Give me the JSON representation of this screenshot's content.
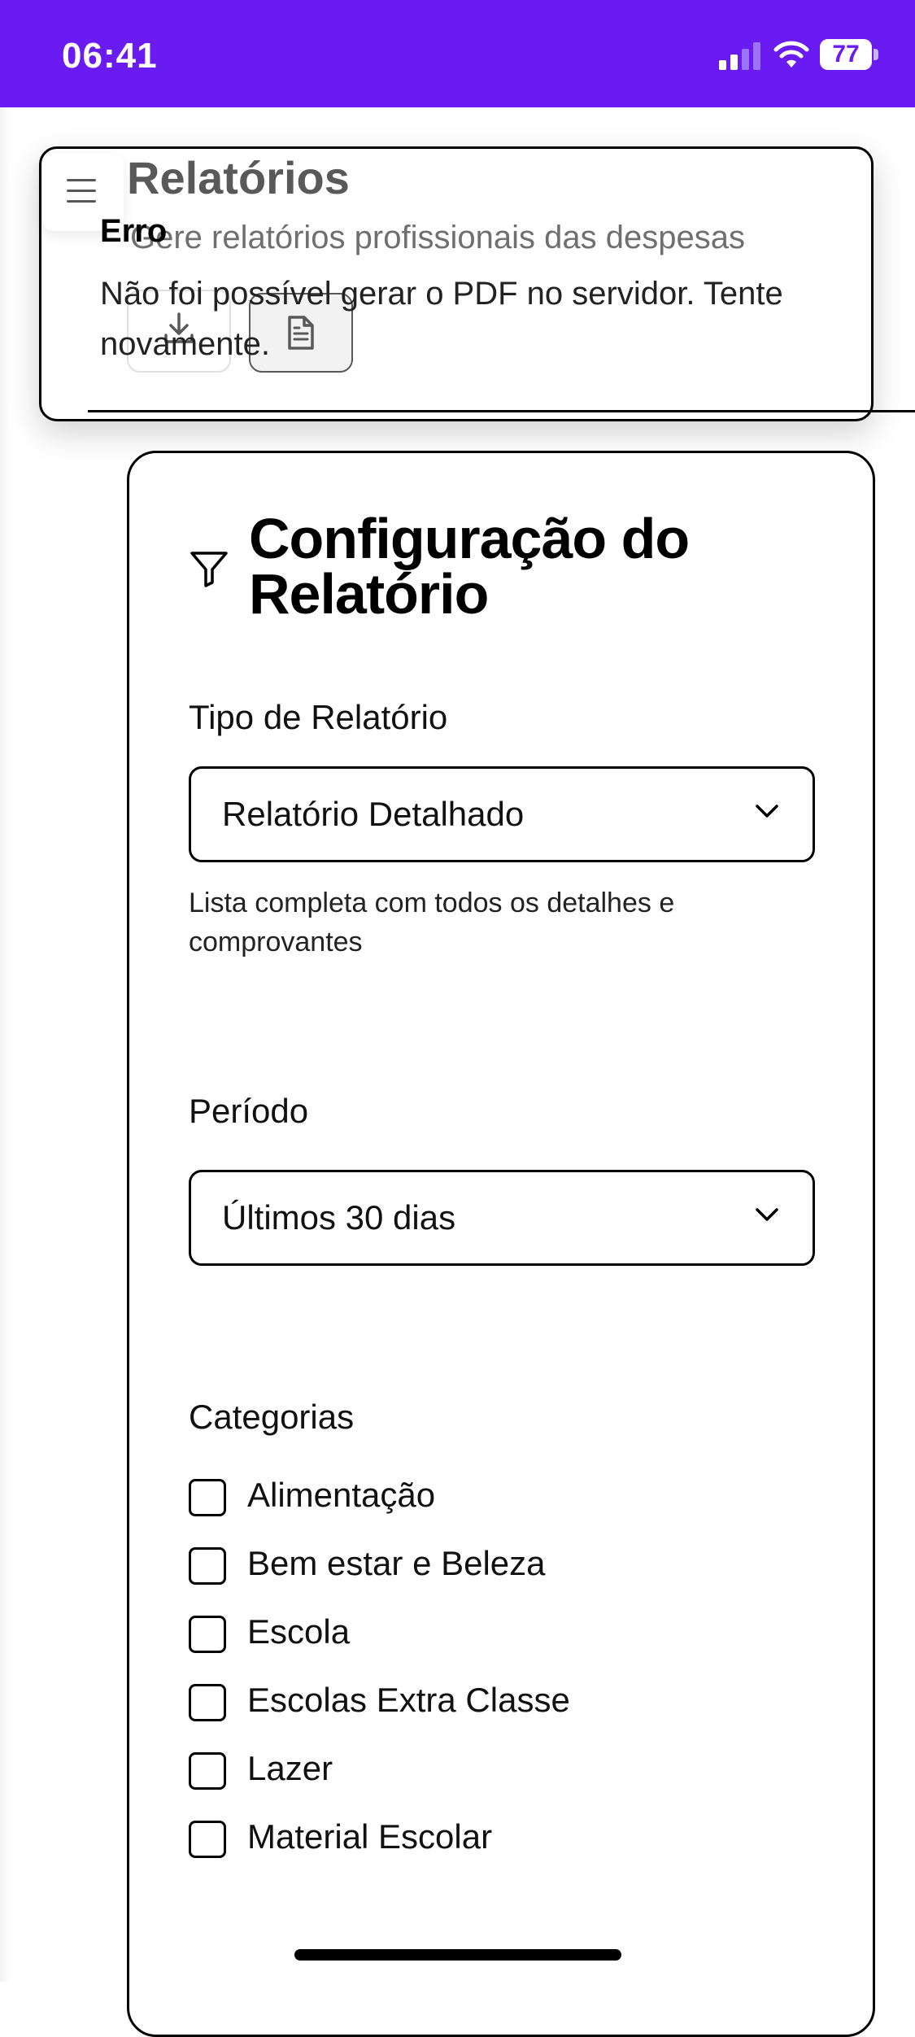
{
  "status_bar": {
    "time": "06:41",
    "battery": "77"
  },
  "header": {
    "title": "Relatórios",
    "subtitle": "Gere relatórios profissionais das despesas"
  },
  "toast": {
    "title": "Erro",
    "message": "Não foi possível gerar o PDF no servidor. Tente novamente."
  },
  "config": {
    "title": "Configuração do Relatório",
    "report_type": {
      "label": "Tipo de Relatório",
      "value": "Relatório Detalhado",
      "help": "Lista completa com todos os detalhes e comprovantes"
    },
    "period": {
      "label": "Período",
      "value": "Últimos 30 dias"
    },
    "categories": {
      "label": "Categorias",
      "items": [
        {
          "label": "Alimentação",
          "checked": false
        },
        {
          "label": "Bem estar e Beleza",
          "checked": false
        },
        {
          "label": "Escola",
          "checked": false
        },
        {
          "label": "Escolas Extra Classe",
          "checked": false
        },
        {
          "label": "Lazer",
          "checked": false
        },
        {
          "label": "Material Escolar",
          "checked": false
        }
      ]
    }
  },
  "colors": {
    "accent": "#6a1bf2"
  }
}
